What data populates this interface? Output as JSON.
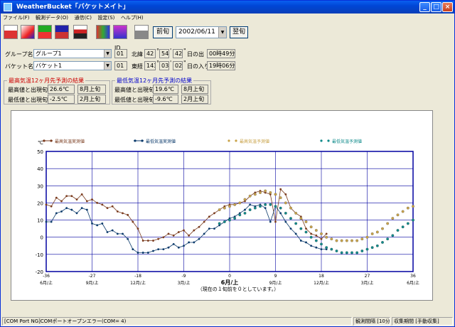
{
  "window": {
    "title": "WeatherBucket「バケットメイト」"
  },
  "menu": [
    "ファイル(F)",
    "観測データ(O)",
    "通信(C)",
    "設定(S)",
    "ヘルプ(H)"
  ],
  "toolbar": {
    "prev_label": "前旬",
    "next_label": "翌旬",
    "date_value": "2002/06/11"
  },
  "id_header": "ID",
  "group": {
    "label": "グループ名",
    "value": "グループ1",
    "id": "01"
  },
  "bucket": {
    "label": "バケット名",
    "value": "バケット1",
    "id": "01"
  },
  "location": {
    "lat_label": "北緯",
    "lat_deg": "42",
    "lat_min": "54",
    "lat_sec": "42",
    "lon_label": "東経",
    "lon_deg": "143",
    "lon_min": "03",
    "lon_sec": "02",
    "sunrise_label": "日の出",
    "sunrise_value": "00時49分",
    "sunset_label": "日の入り",
    "sunset_value": "19時06分"
  },
  "prediction_prev": {
    "title": "最高気温12ヶ月先予測の結果",
    "max_label": "最高値と出現旬",
    "max_value": "26.6℃",
    "max_period": "8月上旬",
    "min_label": "最低値と出現旬",
    "min_value": "-2.5℃",
    "min_period": "2月上旬"
  },
  "prediction_min": {
    "title": "最低気温12ヶ月先予測の結果",
    "max_label": "最高値と出現旬",
    "max_value": "19.6℃",
    "max_period": "8月上旬",
    "min_label": "最低値と出現旬",
    "min_value": "-9.6℃",
    "min_period": "2月上旬"
  },
  "status": {
    "message": "[COM Port NG]COMポートオープンエラー(COM= 4)",
    "interval": "観測間隔 [10分]",
    "mode": "収集期間 [手動収集]"
  },
  "chart_data": {
    "type": "line",
    "y_unit": "℃",
    "ylim": [
      -20,
      50
    ],
    "yticks": [
      50,
      40,
      30,
      20,
      10,
      0,
      -10,
      -20
    ],
    "xlim": [
      -36,
      36
    ],
    "xticks": [
      {
        "v": -36,
        "top": "-36",
        "bot": "6月/上"
      },
      {
        "v": -27,
        "top": "-27",
        "bot": "9月/上"
      },
      {
        "v": -18,
        "top": "-18",
        "bot": "12月/上"
      },
      {
        "v": -9,
        "top": "-9",
        "bot": "3月/上"
      },
      {
        "v": 0,
        "top": "0",
        "bot": ""
      },
      {
        "v": 9,
        "top": "9",
        "bot": "9月/上"
      },
      {
        "v": 18,
        "top": "18",
        "bot": "12月/上"
      },
      {
        "v": 27,
        "top": "27",
        "bot": "3月/上"
      },
      {
        "v": 36,
        "top": "36",
        "bot": "6月/上"
      }
    ],
    "center_label": "6月/上",
    "note": "（現在の１旬前を０としています。）",
    "grid": true,
    "series": [
      {
        "name": "最高気温実測値",
        "color": "#7a3b1e",
        "style": "line",
        "x": [
          -36,
          -35,
          -34,
          -33,
          -32,
          -31,
          -30,
          -29,
          -28,
          -27,
          -26,
          -25,
          -24,
          -23,
          -22,
          -21,
          -20,
          -19,
          -18,
          -17,
          -16,
          -15,
          -14,
          -13,
          -12,
          -11,
          -10,
          -9,
          -8,
          -7,
          -6,
          -5,
          -4,
          -3,
          -2,
          -1,
          0,
          1,
          2,
          3,
          4,
          5,
          6,
          7,
          8,
          9,
          10,
          11,
          12,
          13,
          14,
          15,
          16,
          17,
          18,
          19
        ],
        "y": [
          19,
          18,
          23,
          21,
          24,
          24,
          22,
          25,
          21,
          22,
          20,
          19,
          17,
          18,
          15,
          14,
          13,
          9,
          5,
          -2,
          -2,
          -2,
          -1,
          0,
          2,
          1,
          3,
          4,
          1,
          4,
          6,
          9,
          12,
          14,
          16,
          18,
          19,
          19,
          20,
          21,
          24,
          26,
          27,
          26,
          25,
          9,
          28,
          25,
          17,
          14,
          12,
          5,
          2,
          1,
          -1,
          2
        ],
        "legend_x": "最高気温実測値"
      },
      {
        "name": "最低気温実測値",
        "color": "#0b3a6b",
        "style": "line",
        "x": [
          -36,
          -35,
          -34,
          -33,
          -32,
          -31,
          -30,
          -29,
          -28,
          -27,
          -26,
          -25,
          -24,
          -23,
          -22,
          -21,
          -20,
          -19,
          -18,
          -17,
          -16,
          -15,
          -14,
          -13,
          -12,
          -11,
          -10,
          -9,
          -8,
          -7,
          -6,
          -5,
          -4,
          -3,
          -2,
          -1,
          0,
          1,
          2,
          3,
          4,
          5,
          6,
          7,
          8,
          9,
          10,
          11,
          12,
          13,
          14,
          15,
          16,
          17,
          18,
          19
        ],
        "y": [
          9,
          9,
          14,
          15,
          17,
          16,
          14,
          17,
          16,
          8,
          7,
          8,
          3,
          4,
          2,
          2,
          -1,
          -7,
          -9,
          -9,
          -9,
          -8,
          -7,
          -7,
          -6,
          -4,
          -6,
          -5,
          -3,
          -3,
          -1,
          2,
          5,
          5,
          7,
          9,
          11,
          12,
          14,
          16,
          19,
          18,
          19,
          17,
          9,
          18,
          14,
          9,
          5,
          2,
          -2,
          -3,
          -5,
          -6,
          -7,
          -7
        ]
      },
      {
        "name": "最高気温予測値",
        "color": "#c9a349",
        "style": "dots",
        "x": [
          -2,
          -1,
          0,
          1,
          2,
          3,
          4,
          5,
          6,
          7,
          8,
          9,
          10,
          11,
          12,
          13,
          14,
          15,
          16,
          17,
          18,
          19,
          20,
          21,
          22,
          23,
          24,
          25,
          26,
          27,
          28,
          29,
          30,
          31,
          32,
          33,
          34,
          35,
          36
        ],
        "y": [
          16,
          17,
          18,
          19,
          20,
          22,
          24,
          25,
          26,
          27,
          26,
          25,
          23,
          20,
          17,
          14,
          11,
          9,
          6,
          4,
          2,
          0,
          -1,
          -2,
          -2,
          -2,
          -2,
          -2,
          -1,
          0,
          2,
          3,
          5,
          8,
          11,
          13,
          15,
          17,
          18
        ]
      },
      {
        "name": "最低気温予測値",
        "color": "#0e8a8a",
        "style": "dots",
        "x": [
          -2,
          -1,
          0,
          1,
          2,
          3,
          4,
          5,
          6,
          7,
          8,
          9,
          10,
          11,
          12,
          13,
          14,
          15,
          16,
          17,
          18,
          19,
          20,
          21,
          22,
          23,
          24,
          25,
          26,
          27,
          28,
          29,
          30,
          31,
          32,
          33,
          34,
          35,
          36
        ],
        "y": [
          8,
          9,
          10,
          11,
          13,
          14,
          16,
          17,
          18,
          19,
          19,
          18,
          17,
          14,
          11,
          8,
          5,
          3,
          0,
          -2,
          -4,
          -6,
          -7,
          -8,
          -9,
          -9,
          -9,
          -9,
          -8,
          -7,
          -6,
          -5,
          -3,
          -1,
          1,
          4,
          6,
          8,
          10
        ]
      }
    ]
  }
}
